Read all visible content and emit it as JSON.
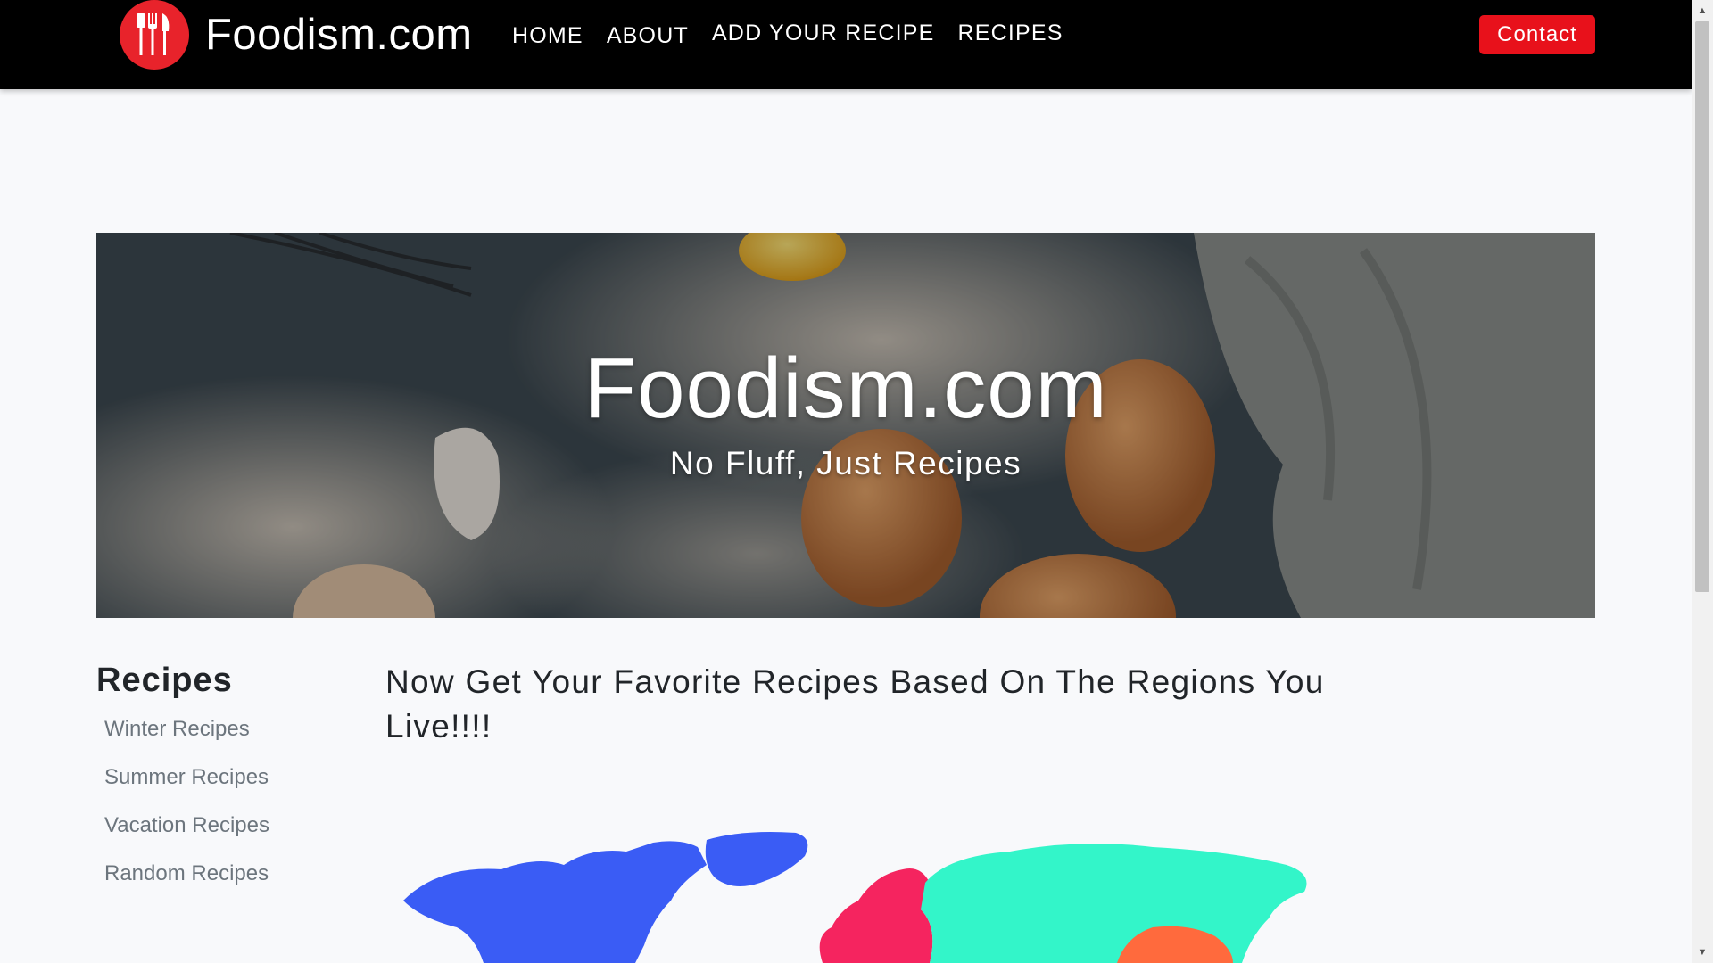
{
  "navbar": {
    "brand": "Foodism.com",
    "links": [
      {
        "label": "HOME"
      },
      {
        "label": "ABOUT"
      },
      {
        "label": "ADD YOUR RECIPE"
      },
      {
        "label": "RECIPES"
      }
    ],
    "contact_label": "Contact"
  },
  "hero": {
    "title": "Foodism.com",
    "subtitle": "No Fluff, Just Recipes"
  },
  "sidebar": {
    "title": "Recipes",
    "items": [
      {
        "label": "Winter Recipes"
      },
      {
        "label": "Summer Recipes"
      },
      {
        "label": "Vacation Recipes"
      },
      {
        "label": "Random Recipes"
      }
    ]
  },
  "main": {
    "heading": "Now Get Your Favorite Recipes Based On The Regions You Live!!!!"
  },
  "colors": {
    "accent": "#e8111b",
    "north_america": "#3a5cf5",
    "europe": "#f5245f",
    "asia": "#33f5c9",
    "south_asia": "#ff6a3d"
  }
}
